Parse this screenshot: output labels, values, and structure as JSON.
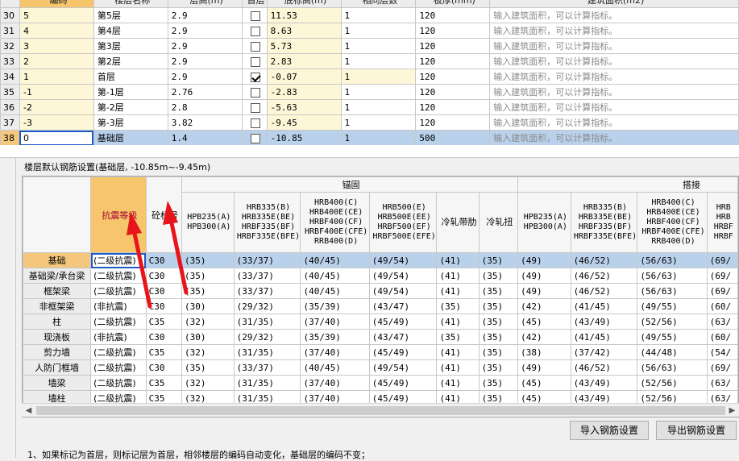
{
  "floor_table": {
    "columns": [
      "编码",
      "楼层名称",
      "层高(m)",
      "首层",
      "底标高(m)",
      "相同层数",
      "板厚(mm)",
      "建筑面积(m2)"
    ],
    "rows": [
      {
        "num": "30",
        "code": "5",
        "name": "第5层",
        "height": "2.9",
        "first": false,
        "elev": "11.53",
        "same": "1",
        "thick": "120",
        "area": "输入建筑面积，可以计算指标。"
      },
      {
        "num": "31",
        "code": "4",
        "name": "第4层",
        "height": "2.9",
        "first": false,
        "elev": "8.63",
        "same": "1",
        "thick": "120",
        "area": "输入建筑面积，可以计算指标。"
      },
      {
        "num": "32",
        "code": "3",
        "name": "第3层",
        "height": "2.9",
        "first": false,
        "elev": "5.73",
        "same": "1",
        "thick": "120",
        "area": "输入建筑面积，可以计算指标。"
      },
      {
        "num": "33",
        "code": "2",
        "name": "第2层",
        "height": "2.9",
        "first": false,
        "elev": "2.83",
        "same": "1",
        "thick": "120",
        "area": "输入建筑面积，可以计算指标。"
      },
      {
        "num": "34",
        "code": "1",
        "name": "首层",
        "height": "2.9",
        "first": true,
        "elev": "-0.07",
        "same": "1",
        "thick": "120",
        "area": "输入建筑面积，可以计算指标。"
      },
      {
        "num": "35",
        "code": "-1",
        "name": "第-1层",
        "height": "2.76",
        "first": false,
        "elev": "-2.83",
        "same": "1",
        "thick": "120",
        "area": "输入建筑面积，可以计算指标。"
      },
      {
        "num": "36",
        "code": "-2",
        "name": "第-2层",
        "height": "2.8",
        "first": false,
        "elev": "-5.63",
        "same": "1",
        "thick": "120",
        "area": "输入建筑面积，可以计算指标。"
      },
      {
        "num": "37",
        "code": "-3",
        "name": "第-3层",
        "height": "3.82",
        "first": false,
        "elev": "-9.45",
        "same": "1",
        "thick": "120",
        "area": "输入建筑面积，可以计算指标。"
      },
      {
        "num": "38",
        "code": "0",
        "name": "基础层",
        "height": "1.4",
        "first": false,
        "elev": "-10.85",
        "same": "1",
        "thick": "500",
        "area": "输入建筑面积，可以计算指标。"
      }
    ]
  },
  "rebar": {
    "title": "楼层默认钢筋设置(基础层, -10.85m~-9.45m)",
    "group_anchor": "锚固",
    "group_lap": "搭接",
    "col_grade": "抗震等级",
    "col_concrete": "砼标号",
    "sub_headers": [
      "HPB235(A)\nHPB300(A)",
      "HRB335(B)\nHRB335E(BE)\nHRBF335(BF)\nHRBF335E(BFE)",
      "HRB400(C)\nHRB400E(CE)\nHRBF400(CF)\nHRBF400E(CFE)\nRRB400(D)",
      "HRB500(E)\nHRB500E(EE)\nHRBF500(EF)\nHRBF500E(EFE)",
      "冷轧带肋",
      "冷轧扭",
      "HPB235(A)\nHPB300(A)",
      "HRB335(B)\nHRB335E(BE)\nHRBF335(BF)\nHRBF335E(BFE)",
      "HRB400(C)\nHRB400E(CE)\nHRBF400(CF)\nHRBF400E(CFE)\nRRB400(D)",
      "HRB\nHRB\nHRBF\nHRBF"
    ],
    "rows": [
      {
        "comp": "基础",
        "grade": "(二级抗震)",
        "conc": "C30",
        "vals": [
          "(35)",
          "(33/37)",
          "(40/45)",
          "(49/54)",
          "(41)",
          "(35)",
          "(49)",
          "(46/52)",
          "(56/63)",
          "(69/"
        ]
      },
      {
        "comp": "基础梁/承台梁",
        "grade": "(二级抗震)",
        "conc": "C30",
        "vals": [
          "(35)",
          "(33/37)",
          "(40/45)",
          "(49/54)",
          "(41)",
          "(35)",
          "(49)",
          "(46/52)",
          "(56/63)",
          "(69/"
        ]
      },
      {
        "comp": "框架梁",
        "grade": "(二级抗震)",
        "conc": "C30",
        "vals": [
          "(35)",
          "(33/37)",
          "(40/45)",
          "(49/54)",
          "(41)",
          "(35)",
          "(49)",
          "(46/52)",
          "(56/63)",
          "(69/"
        ]
      },
      {
        "comp": "非框架梁",
        "grade": "(非抗震)",
        "conc": "C30",
        "vals": [
          "(30)",
          "(29/32)",
          "(35/39)",
          "(43/47)",
          "(35)",
          "(35)",
          "(42)",
          "(41/45)",
          "(49/55)",
          "(60/"
        ]
      },
      {
        "comp": "柱",
        "grade": "(二级抗震)",
        "conc": "C35",
        "vals": [
          "(32)",
          "(31/35)",
          "(37/40)",
          "(45/49)",
          "(41)",
          "(35)",
          "(45)",
          "(43/49)",
          "(52/56)",
          "(63/"
        ]
      },
      {
        "comp": "现浇板",
        "grade": "(非抗震)",
        "conc": "C30",
        "vals": [
          "(30)",
          "(29/32)",
          "(35/39)",
          "(43/47)",
          "(35)",
          "(35)",
          "(42)",
          "(41/45)",
          "(49/55)",
          "(60/"
        ]
      },
      {
        "comp": "剪力墙",
        "grade": "(二级抗震)",
        "conc": "C35",
        "vals": [
          "(32)",
          "(31/35)",
          "(37/40)",
          "(45/49)",
          "(41)",
          "(35)",
          "(38)",
          "(37/42)",
          "(44/48)",
          "(54/"
        ]
      },
      {
        "comp": "人防门框墙",
        "grade": "(二级抗震)",
        "conc": "C30",
        "vals": [
          "(35)",
          "(33/37)",
          "(40/45)",
          "(49/54)",
          "(41)",
          "(35)",
          "(49)",
          "(46/52)",
          "(56/63)",
          "(69/"
        ]
      },
      {
        "comp": "墙梁",
        "grade": "(二级抗震)",
        "conc": "C35",
        "vals": [
          "(32)",
          "(31/35)",
          "(37/40)",
          "(45/49)",
          "(41)",
          "(35)",
          "(45)",
          "(43/49)",
          "(52/56)",
          "(63/"
        ]
      },
      {
        "comp": "墙柱",
        "grade": "(二级抗震)",
        "conc": "C35",
        "vals": [
          "(32)",
          "(31/35)",
          "(37/40)",
          "(45/49)",
          "(41)",
          "(35)",
          "(45)",
          "(43/49)",
          "(52/56)",
          "(63/"
        ]
      }
    ]
  },
  "buttons": {
    "import": "导入钢筋设置",
    "export": "导出钢筋设置"
  },
  "note": "1、如果标记为首层，则标记层为首层，相邻楼层的编码自动变化，基础层的编码不变；",
  "colors": {
    "selected_row": "#b9d1ea",
    "header_orange": "#f7c56b",
    "arrow_red": "#e8141b",
    "editable_yellow": "#fdf6d7"
  }
}
